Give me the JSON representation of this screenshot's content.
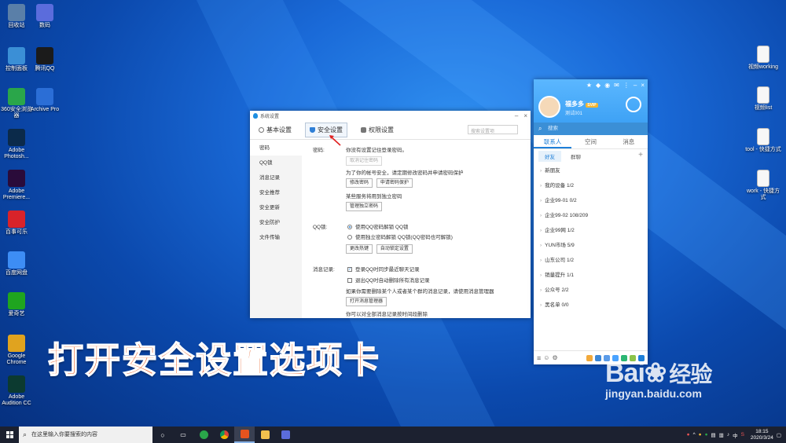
{
  "desktop_left": [
    {
      "label": "回收站",
      "icon": "recycle-bin-icon",
      "color": "#5a7fa8"
    },
    {
      "label": "数码",
      "icon": "app-icon",
      "color": "#5b6cdc"
    },
    {
      "label": "控制面板",
      "icon": "control-panel-icon",
      "color": "#3b8fd6"
    },
    {
      "label": "腾讯QQ",
      "icon": "qq-icon",
      "color": "#1b1b1b"
    },
    {
      "label": "360安全浏览器",
      "icon": "browser-360-icon",
      "color": "#2aa64a"
    },
    {
      "label": "Archive Pro",
      "icon": "archive-icon",
      "color": "#2b6ed6"
    },
    {
      "label": "Adobe Photosh...",
      "icon": "photoshop-icon",
      "color": "#0b2a4a"
    },
    {
      "label": "Adobe Premiere...",
      "icon": "premiere-icon",
      "color": "#2a0b3a"
    },
    {
      "label": "百事可乐",
      "icon": "pepsi-icon",
      "color": "#d8232a"
    },
    {
      "label": "百度网盘",
      "icon": "baidu-netdisk-icon",
      "color": "#3d8df5"
    },
    {
      "label": "爱奇艺",
      "icon": "iqiyi-icon",
      "color": "#1fa51f"
    },
    {
      "label": "Google Chrome",
      "icon": "chrome-icon",
      "color": "#e0a31f"
    },
    {
      "label": "Adobe Audition CC",
      "icon": "audition-icon",
      "color": "#0c3a30"
    }
  ],
  "desktop_right": [
    {
      "label": "视频working",
      "icon": "file-icon"
    },
    {
      "label": "视频list",
      "icon": "file-icon"
    },
    {
      "label": "tool - 快捷方式",
      "icon": "shortcut-icon"
    },
    {
      "label": "work - 快捷方式",
      "icon": "shortcut-icon"
    }
  ],
  "settings": {
    "title": "系统设置",
    "tabs": [
      "基本设置",
      "安全设置",
      "权限设置"
    ],
    "search_placeholder": "搜索设置项",
    "side": [
      "密码",
      "QQ锁",
      "消息记录",
      "安全推荐",
      "安全更新",
      "安全防护",
      "文件传输"
    ],
    "pwd_label": "密码:",
    "pwd_desc": "你没有设置记住登录密码。",
    "pwd_cancel_btn": "取消记住密码",
    "pwd_tip": "为了你的帐号安全，请定期修改密码并申请密码保护",
    "btn_change_pwd": "修改密码",
    "btn_apply_protect": "申请密码保护",
    "sep_tip": "某些服务将用到独立密码",
    "btn_manage_pwd": "管理独立密码",
    "lock_label": "QQ锁:",
    "lock_opt1": "使用QQ密码解锁 QQ锁",
    "lock_opt2": "使用独立密码解锁 QQ锁(QQ密码也可解锁)",
    "btn_hotkey": "更改热键",
    "btn_autolock": "自动锁定设置",
    "msg_label": "消息记录:",
    "msg_opt1": "登录QQ时同步最近聊天记录",
    "msg_opt2": "退出QQ时自动删除所有消息记录",
    "msg_tip": "如果你需要删除某个人或者某个群的消息记录，请使用消息管理器",
    "btn_msg_mgr": "打开消息管理器",
    "msg_tip2": "你可以对全部消息记录按时间段删除"
  },
  "qq": {
    "nickname": "福多多",
    "vip": "SVIP",
    "signature": "测试001",
    "search_placeholder": "搜索",
    "tabs": [
      "联系人",
      "空间",
      "消息"
    ],
    "subtabs": [
      "好友",
      "群聊"
    ],
    "groups": [
      "新朋友",
      "我的设备 1/2",
      "企业99-01 0/2",
      "企业99-02 108/209",
      "企业99网 1/2",
      "YUN市场 5/9",
      "山东公司 1/2",
      "销量提升 1/1",
      "公众号 2/2",
      "黑名单 0/0"
    ]
  },
  "banner": "打开安全设置选项卡",
  "watermark": {
    "logo": "Bai",
    "logo_cn": "经验",
    "url": "jingyan.baidu.com"
  },
  "taskbar": {
    "search_placeholder": "在这里输入你要搜索的内容",
    "time": "18:15",
    "date": "2020/3/24",
    "lang": "中"
  }
}
